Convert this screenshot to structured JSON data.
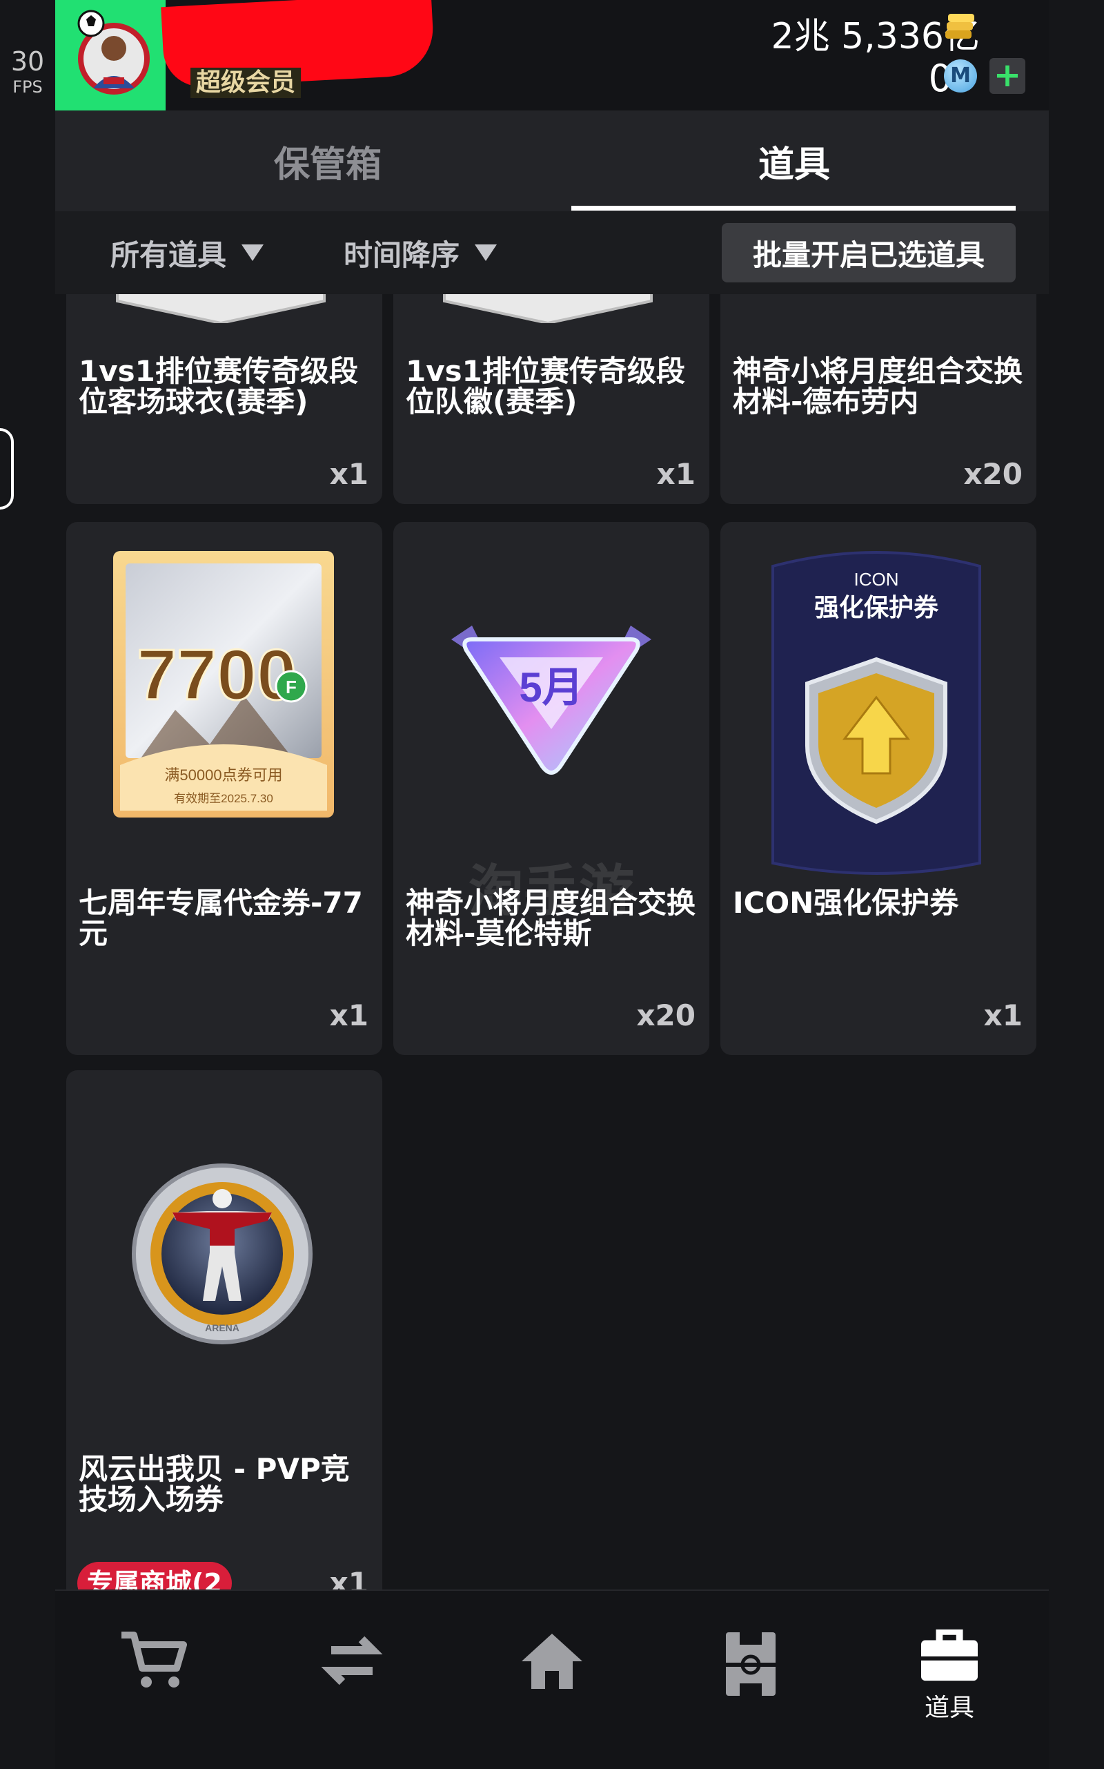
{
  "fps": {
    "value": "30",
    "label": "FPS"
  },
  "header": {
    "vip_label": "超级会员",
    "coins": "2兆 5,336亿",
    "m_points": "0",
    "m_icon_text": "M",
    "plus_glyph": "+"
  },
  "tabs": [
    {
      "label": "保管箱",
      "active": false
    },
    {
      "label": "道具",
      "active": true
    }
  ],
  "filters": {
    "category": "所有道具",
    "sort": "时间降序",
    "batch_open": "批量开启已选道具"
  },
  "items": [
    {
      "name": "1vs1排位赛传奇级段位客场球衣(赛季)",
      "qty": "x1",
      "icon": "jersey-icon"
    },
    {
      "name": "1vs1排位赛传奇级段位队徽(赛季)",
      "qty": "x1",
      "icon": "team-crest-icon"
    },
    {
      "name": "神奇小将月度组合交换材料-德布劳内",
      "qty": "x20",
      "icon": "material-icon"
    },
    {
      "name": "七周年专属代金券-77元",
      "qty": "x1",
      "icon": "voucher-icon",
      "art": {
        "amount": "7700",
        "badge": "F",
        "condition": "满50000点券可用",
        "validity": "有效期至2025.7.30"
      }
    },
    {
      "name": "神奇小将月度组合交换材料-莫伦特斯",
      "qty": "x20",
      "icon": "monthly-material-icon",
      "art": {
        "text": "5月"
      }
    },
    {
      "name": "ICON强化保护券",
      "qty": "x1",
      "icon": "shield-icon",
      "art": {
        "top": "ICON",
        "title": "强化保护券"
      }
    },
    {
      "name": "风云出我贝 - PVP竞技场入场券",
      "qty": "x1",
      "icon": "arena-ticket-icon",
      "art": {
        "ring_text": "ARENA"
      }
    }
  ],
  "watermark": "淘手游",
  "promo_badge": "专属商城(2",
  "nav": [
    {
      "icon": "cart-icon",
      "label": ""
    },
    {
      "icon": "transfer-icon",
      "label": ""
    },
    {
      "icon": "home-icon",
      "label": ""
    },
    {
      "icon": "pitch-icon",
      "label": ""
    },
    {
      "icon": "bag-icon",
      "label": "道具",
      "active": true
    }
  ]
}
